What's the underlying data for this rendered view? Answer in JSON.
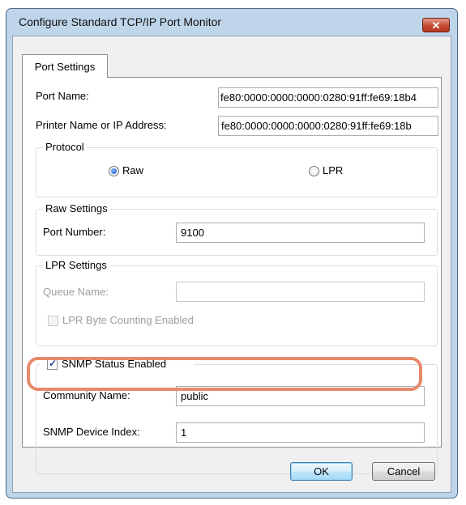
{
  "window": {
    "title": "Configure Standard TCP/IP Port Monitor",
    "close_symbol": "✕"
  },
  "tabs": [
    {
      "label": "Port Settings"
    }
  ],
  "port_settings": {
    "port_name": {
      "label": "Port Name:",
      "value": "fe80:0000:0000:0000:0280:91ff:fe69:18b4"
    },
    "printer_address": {
      "label": "Printer Name or IP Address:",
      "value": "fe80:0000:0000:0000:0280:91ff:fe69:18b"
    },
    "protocol": {
      "legend": "Protocol",
      "options": [
        {
          "label": "Raw",
          "selected": true
        },
        {
          "label": "LPR",
          "selected": false
        }
      ]
    },
    "raw_settings": {
      "legend": "Raw Settings",
      "port_number_label": "Port Number:",
      "port_number_value": "9100"
    },
    "lpr_settings": {
      "legend": "LPR Settings",
      "queue_name_label": "Queue Name:",
      "queue_name_value": "",
      "byte_counting_label": "LPR Byte Counting Enabled",
      "byte_counting_checked": false
    },
    "snmp": {
      "enabled_label": "SNMP Status Enabled",
      "enabled_checked": true,
      "community_name_label": "Community Name:",
      "community_name_value": "public",
      "device_index_label": "SNMP Device Index:",
      "device_index_value": "1"
    }
  },
  "buttons": {
    "ok": "OK",
    "cancel": "Cancel"
  },
  "colors": {
    "highlight": "#e8896a",
    "title_bar": "#bfd5ea",
    "close_button": "#c44c34"
  }
}
